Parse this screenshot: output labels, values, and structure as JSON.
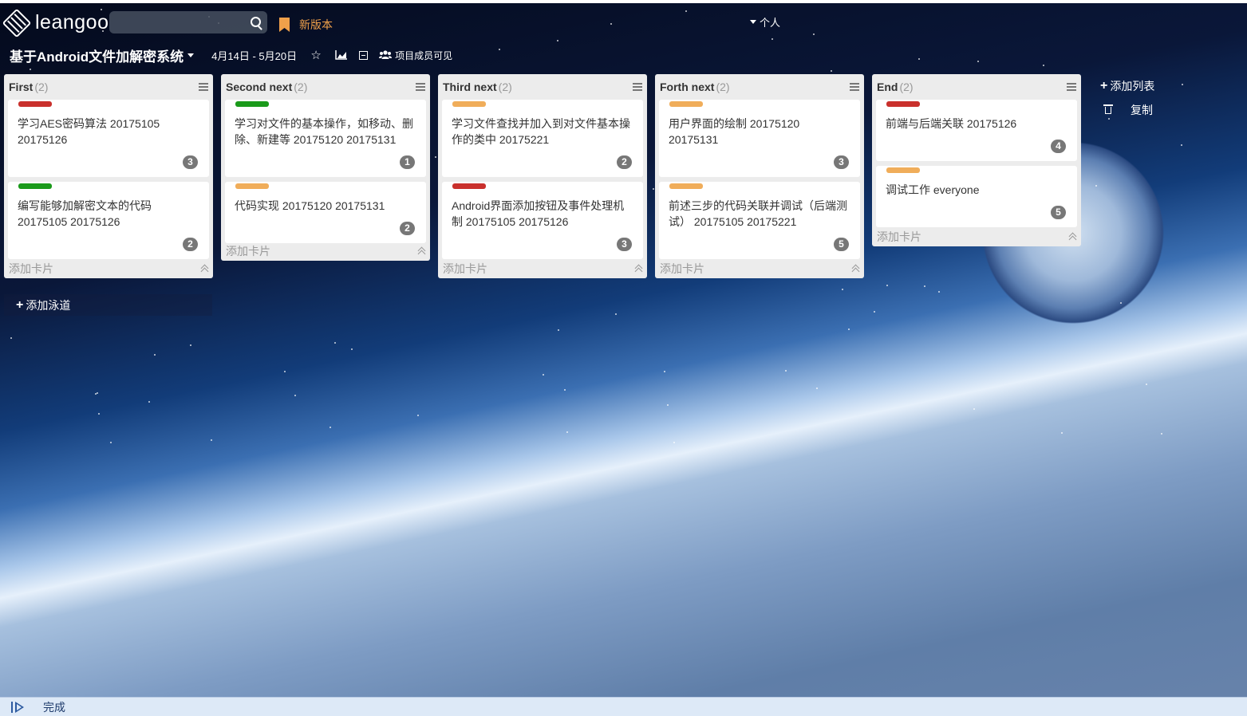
{
  "header": {
    "logo_text": "leangoo",
    "search_placeholder": "",
    "new_version": "新版本",
    "personal": "个人"
  },
  "board": {
    "title": "基于Android文件加解密系统",
    "date_range": "4月14日 - 5月20日",
    "visibility": "项目成员可见"
  },
  "label_colors": {
    "red": "#c9302c",
    "green": "#1a9a1a",
    "orange": "#f0ad5a"
  },
  "lists": [
    {
      "title": "First",
      "count": "(2)",
      "add_card": "添加卡片",
      "cards": [
        {
          "label": "red",
          "text": "学习AES密码算法  20175105 20175126",
          "badge": "3"
        },
        {
          "label": "green",
          "text": "编写能够加解密文本的代码 20175105  20175126",
          "badge": "2"
        }
      ]
    },
    {
      "title": "Second next",
      "count": "(2)",
      "add_card": "添加卡片",
      "cards": [
        {
          "label": "green",
          "text": "学习对文件的基本操作，如移动、删除、新建等  20175120  20175131",
          "badge": "1"
        },
        {
          "label": "orange",
          "text": "代码实现 20175120  20175131",
          "badge": "2"
        }
      ]
    },
    {
      "title": "Third next",
      "count": "(2)",
      "add_card": "添加卡片",
      "cards": [
        {
          "label": "orange",
          "text": "学习文件查找并加入到对文件基本操作的类中  20175221",
          "badge": "2"
        },
        {
          "label": "red",
          "text": "Android界面添加按钮及事件处理机制  20175105  20175126",
          "badge": "3"
        }
      ]
    },
    {
      "title": "Forth next",
      "count": "(2)",
      "add_card": "添加卡片",
      "cards": [
        {
          "label": "orange",
          "text": "用户界面的绘制  20175120 20175131",
          "badge": "3"
        },
        {
          "label": "orange",
          "text": "前述三步的代码关联并调试（后端测试）  20175105 20175221",
          "badge": "5"
        }
      ]
    },
    {
      "title": "End",
      "count": "(2)",
      "add_card": "添加卡片",
      "cards": [
        {
          "label": "red",
          "text": "前端与后端关联  20175126",
          "badge": "4"
        },
        {
          "label": "orange",
          "text": "调试工作  everyone",
          "badge": "5"
        }
      ]
    }
  ],
  "add_lane": "添加泳道",
  "add_list": "添加列表",
  "copy": "复制",
  "status": "完成"
}
